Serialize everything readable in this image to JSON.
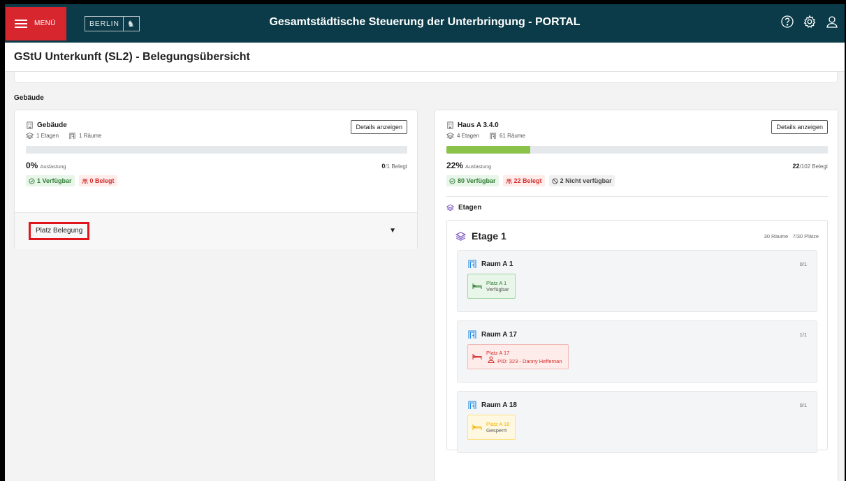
{
  "topbar": {
    "menu_label": "MENÜ",
    "logo_text": "BERLIN",
    "title": "Gesamtstädtische Steuerung der Unterbringung - PORTAL"
  },
  "page": {
    "title": "GStU Unterkunft (SL2) - Belegungsübersicht",
    "section_label": "Gebäude"
  },
  "left_building": {
    "name": "Gebäude",
    "details_button": "Details anzeigen",
    "floors": "1 Etagen",
    "rooms": "1 Räume",
    "fill_fraction": 0,
    "percent": "0%",
    "percent_label": "Auslastung",
    "occupied": "0",
    "total": "/1 Belegt",
    "badge_available": "1 Verfügbar",
    "badge_occupied": "0 Belegt",
    "accordion_label": "Platz Belegung"
  },
  "right_building": {
    "name": "Haus A 3.4.0",
    "details_button": "Details anzeigen",
    "floors": "4 Etagen",
    "rooms": "61 Räume",
    "fill_fraction": 0.22,
    "percent": "22%",
    "percent_label": "Auslastung",
    "occupied": "22",
    "total": "/102 Belegt",
    "badge_available": "80 Verfügbar",
    "badge_occupied": "22 Belegt",
    "badge_unavailable": "2 Nicht verfügbar",
    "etagen_label": "Etagen",
    "etage": {
      "name": "Etage 1",
      "rooms_count": "30 Räume",
      "places_count": "7/30 Plätze",
      "rooms": [
        {
          "name": "Raum A 1",
          "count": "0/1",
          "place": "Platz A 1",
          "status": "Verfügbar",
          "state": "green"
        },
        {
          "name": "Raum A 17",
          "count": "1/1",
          "place": "Platz A 17",
          "status": "PID: 323 - Danny Heffernan",
          "state": "red"
        },
        {
          "name": "Raum A 18",
          "count": "0/1",
          "place": "Platz A 18",
          "status": "Gesperrt",
          "state": "yellow"
        }
      ]
    }
  }
}
